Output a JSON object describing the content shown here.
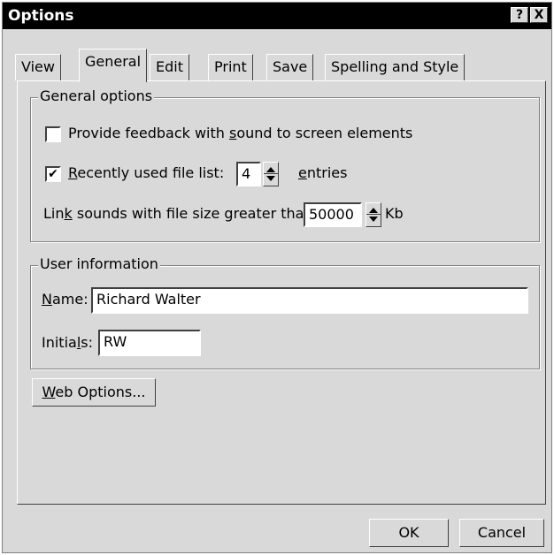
{
  "window": {
    "title": "Options",
    "help_label": "?",
    "close_label": "X"
  },
  "tabs": [
    {
      "label": "View"
    },
    {
      "label": "General"
    },
    {
      "label": "Edit"
    },
    {
      "label": "Print"
    },
    {
      "label": "Save"
    },
    {
      "label": "Spelling and Style"
    }
  ],
  "general_options": {
    "legend": "General options",
    "feedback": {
      "pre": "Provide feedback with ",
      "u": "s",
      "post": "ound to screen elements",
      "checked": false
    },
    "recent": {
      "pre": "",
      "u": "R",
      "post": "ecently used file list:",
      "checked": true,
      "value": "4",
      "mark": "✔",
      "suffix_u": "e",
      "suffix_post": "ntries"
    },
    "link": {
      "pre": "Lin",
      "u": "k",
      "post": " sounds with file size greater than",
      "value": "50000",
      "suffix": "Kb"
    }
  },
  "user_info": {
    "legend": "User information",
    "name": {
      "u": "N",
      "post": "ame:",
      "value": "Richard Walter"
    },
    "initials": {
      "pre": "Initia",
      "u": "l",
      "post": "s:",
      "value": "RW"
    }
  },
  "buttons": {
    "web": {
      "u": "W",
      "post": "eb Options..."
    },
    "ok": "OK",
    "cancel": "Cancel"
  }
}
